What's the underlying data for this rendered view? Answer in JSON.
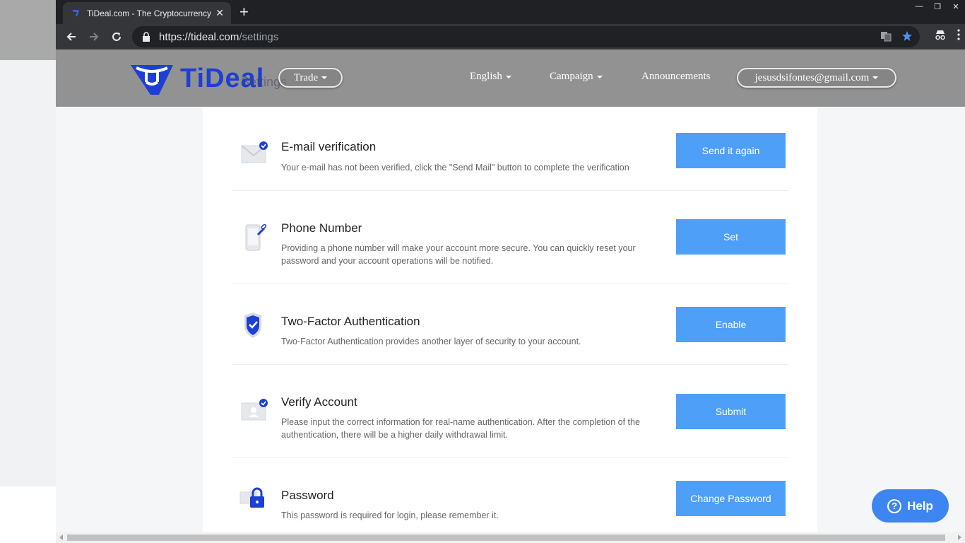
{
  "browser": {
    "tab_title": "TiDeal.com - The Cryptocurrency Ex",
    "url_host": "https://tideal.com",
    "url_path": "/settings"
  },
  "header": {
    "logo_text": "TiDeal",
    "trade_label": "Trade",
    "language_label": "English",
    "campaign_label": "Campaign",
    "announcements_label": "Announcements",
    "account_label": "jesusdsifontes@gmail.com",
    "page_title_ghost": "Settings"
  },
  "settings": {
    "rows": [
      {
        "title": "E-mail verification",
        "desc": "Your e-mail has not been verified, click the \"Send Mail\" button to complete the verification",
        "button": "Send it again",
        "icon": "envelope-check-icon"
      },
      {
        "title": "Phone Number",
        "desc": "Providing a phone number will make your account more secure. You can quickly reset your password and your account operations will be notified.",
        "button": "Set",
        "icon": "phone-link-icon"
      },
      {
        "title": "Two-Factor Authentication",
        "desc": "Two-Factor Authentication provides another layer of security to your account.",
        "button": "Enable",
        "icon": "shield-check-icon"
      },
      {
        "title": "Verify Account",
        "desc": "Please input the correct information for real-name authentication. After the completion of the authentication, there will be a higher daily withdrawal limit.",
        "button": "Submit",
        "icon": "id-card-icon"
      },
      {
        "title": "Password",
        "desc": "This password is required for login, please remember it.",
        "button": "Change Password",
        "icon": "padlock-icon"
      }
    ]
  },
  "help": {
    "label": "Help"
  },
  "colors": {
    "accent": "#4e9ff8",
    "brand": "#1d3fd4",
    "help": "#3d86f2"
  }
}
